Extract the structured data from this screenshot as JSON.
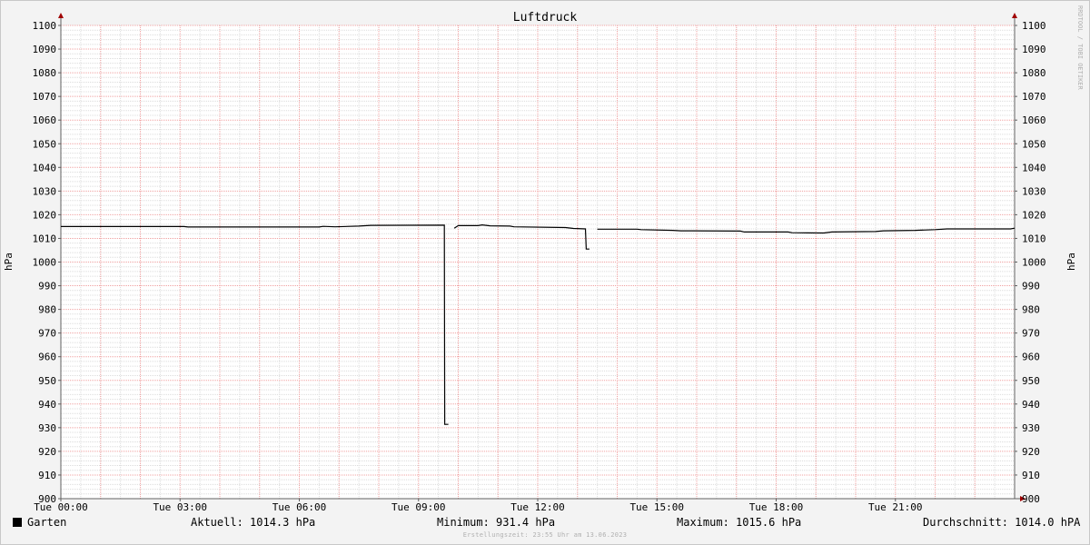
{
  "chart_data": {
    "type": "line",
    "title": "Luftdruck",
    "ylabel": "hPa",
    "ylabel_right": "hPa",
    "watermark": "RRDTOOL / TOBI OETIKER",
    "ylim": [
      900,
      1100
    ],
    "xlim": [
      0,
      24
    ],
    "y_ticks": [
      900,
      910,
      920,
      930,
      940,
      950,
      960,
      970,
      980,
      990,
      1000,
      1010,
      1020,
      1030,
      1040,
      1050,
      1060,
      1070,
      1080,
      1090,
      1100
    ],
    "y_tick_labels": [
      "900",
      "910",
      "920",
      "930",
      "940",
      "950",
      "960",
      "970",
      "980",
      "990",
      "1000",
      "1010",
      "1020",
      "1030",
      "1040",
      "1050",
      "1060",
      "1070",
      "1080",
      "1090",
      "1100"
    ],
    "x_ticks": [
      0,
      3,
      6,
      9,
      12,
      15,
      18,
      21
    ],
    "x_tick_labels": [
      "Tue 00:00",
      "Tue 03:00",
      "Tue 06:00",
      "Tue 09:00",
      "Tue 12:00",
      "Tue 15:00",
      "Tue 18:00",
      "Tue 21:00"
    ],
    "grid": true,
    "series": [
      {
        "name": "Garten",
        "color": "#000000",
        "segments": [
          [
            [
              0.0,
              1015.0
            ],
            [
              3.1,
              1015.0
            ],
            [
              3.2,
              1014.8
            ],
            [
              6.5,
              1014.8
            ],
            [
              6.6,
              1015.1
            ],
            [
              6.9,
              1014.9
            ],
            [
              7.5,
              1015.2
            ],
            [
              7.8,
              1015.5
            ],
            [
              9.65,
              1015.6
            ],
            [
              9.66,
              931.4
            ],
            [
              9.75,
              931.4
            ]
          ],
          [
            [
              9.9,
              1014.3
            ],
            [
              10.0,
              1015.4
            ],
            [
              10.5,
              1015.4
            ],
            [
              10.6,
              1015.7
            ],
            [
              10.8,
              1015.3
            ],
            [
              11.3,
              1015.2
            ],
            [
              11.4,
              1014.9
            ],
            [
              12.7,
              1014.6
            ],
            [
              12.9,
              1014.2
            ],
            [
              13.2,
              1014.0
            ],
            [
              13.22,
              1005.5
            ],
            [
              13.3,
              1005.5
            ]
          ],
          [
            [
              13.5,
              1013.9
            ],
            [
              14.5,
              1013.9
            ],
            [
              14.6,
              1013.7
            ],
            [
              15.4,
              1013.4
            ],
            [
              15.6,
              1013.2
            ],
            [
              17.1,
              1013.1
            ],
            [
              17.2,
              1012.7
            ],
            [
              18.3,
              1012.7
            ],
            [
              18.4,
              1012.4
            ],
            [
              19.2,
              1012.3
            ],
            [
              19.4,
              1012.7
            ],
            [
              20.5,
              1012.9
            ],
            [
              20.7,
              1013.2
            ],
            [
              21.5,
              1013.4
            ],
            [
              22.0,
              1013.7
            ],
            [
              22.3,
              1014.0
            ],
            [
              23.9,
              1014.0
            ],
            [
              24.0,
              1014.3
            ]
          ]
        ]
      }
    ]
  },
  "legend": {
    "series_name": "Garten",
    "swatch_color": "#000000",
    "current": "Aktuell: 1014.3 hPa",
    "minimum": "Minimum: 931.4 hPa",
    "maximum": "Maximum: 1015.6 hPa",
    "average": "Durchschnitt: 1014.0 hPA"
  },
  "footer": "Erstellungszeit: 23:55 Uhr am 13.06.2023",
  "colors": {
    "background": "#f3f3f3",
    "plot_background": "#ffffff",
    "minor_grid": "#dcdcdc",
    "major_grid": "#f0a0a0",
    "axis": "#606060",
    "arrow": "#a00000"
  }
}
